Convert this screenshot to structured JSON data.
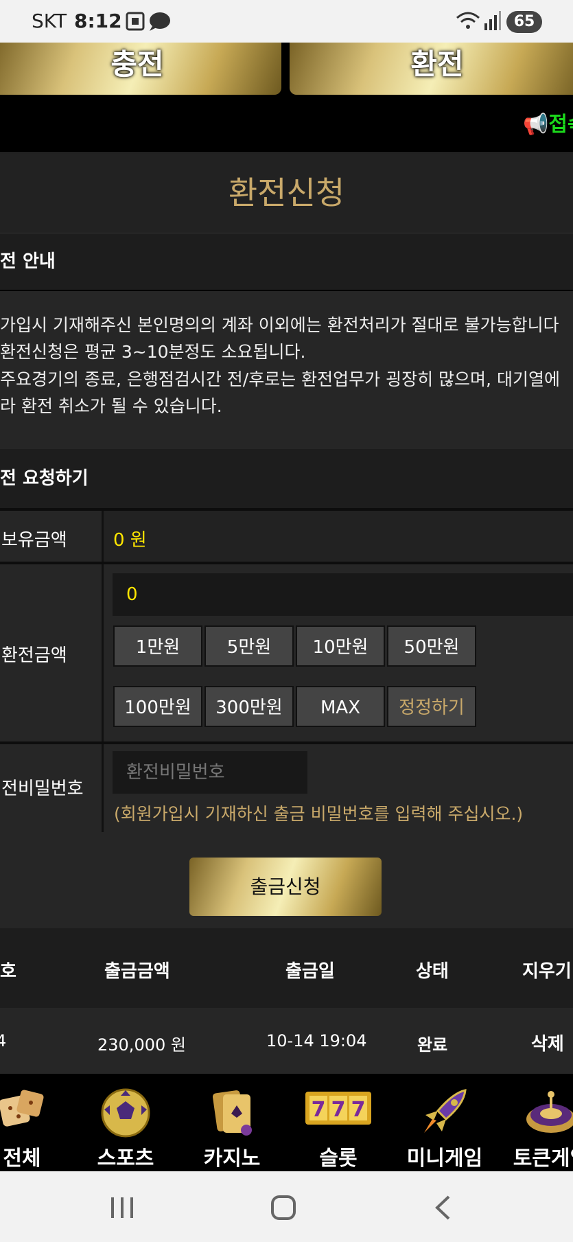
{
  "status_bar": {
    "carrier": "SKT",
    "time": "8:12",
    "battery": "65"
  },
  "top_buttons": {
    "deposit": "충전",
    "withdraw": "환전"
  },
  "marquee": {
    "text": "📢접속"
  },
  "page": {
    "title": "환전신청"
  },
  "notice": {
    "heading": "전 안내",
    "lines": [
      "가입시 기재해주신 본인명의의 계좌 이외에는 환전처리가 절대로 불가능합니다",
      "환전신청은 평균 3~10분정도 소요됩니다.",
      "주요경기의 종료, 은행점검시간 전/후로는 환전업무가 굉장히 많으며, 대기열에",
      "라 환전 취소가 될 수 있습니다."
    ]
  },
  "request": {
    "heading": "전 요청하기",
    "balance_label": "보유금액",
    "balance_value": "0 원",
    "amount_label": "환전금액",
    "amount_value": "0",
    "chips": [
      "1만원",
      "5만원",
      "10만원",
      "50만원",
      "100만원",
      "300만원",
      "MAX",
      "정정하기"
    ],
    "password_label": "전비밀번호",
    "password_placeholder": "환전비밀번호",
    "password_hint": "(회원가입시 기재하신 출금 비밀번호를 입력해 주십시오.)",
    "submit_label": "출금신청"
  },
  "history": {
    "headers": [
      "호",
      "출금금액",
      "출금일",
      "상태",
      "지우기"
    ],
    "rows": [
      {
        "no": "4",
        "amount": "230,000 원",
        "date": "10-14 19:04",
        "status": "완료",
        "action": "삭제"
      }
    ]
  },
  "bottom_nav": [
    "전체",
    "스포츠",
    "카지노",
    "슬롯",
    "미니게임",
    "토큰게임"
  ],
  "colors": {
    "accent_gold": "#c9a96a",
    "value_yellow": "#ffe600",
    "marquee_green": "#1bd81b"
  }
}
